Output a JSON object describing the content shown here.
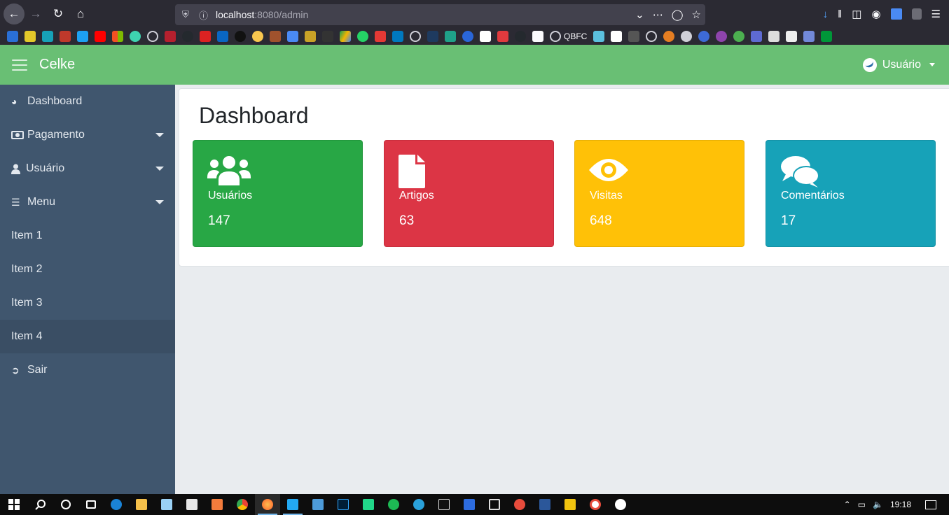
{
  "browser": {
    "url_host": "localhost",
    "url_path": ":8080/admin",
    "bookmark_qbfc": "QBFC"
  },
  "navbar": {
    "brand": "Celke",
    "user_label": "Usuário"
  },
  "sidebar": {
    "items": [
      {
        "label": "Dashboard",
        "icon": "tachometer-icon"
      },
      {
        "label": "Pagamento",
        "icon": "money-icon"
      },
      {
        "label": "Usuário",
        "icon": "user-icon"
      },
      {
        "label": "Menu",
        "icon": "list-icon"
      },
      {
        "label": "Item 1"
      },
      {
        "label": "Item 2"
      },
      {
        "label": "Item 3"
      },
      {
        "label": "Item 4"
      },
      {
        "label": "Sair",
        "icon": "sign-out-icon"
      }
    ]
  },
  "main": {
    "title": "Dashboard",
    "cards": [
      {
        "label": "Usuários",
        "value": "147",
        "color": "#28a745",
        "icon": "users-icon"
      },
      {
        "label": "Artigos",
        "value": "63",
        "color": "#dc3545",
        "icon": "file-icon"
      },
      {
        "label": "Visitas",
        "value": "648",
        "color": "#ffc107",
        "icon": "eye-icon"
      },
      {
        "label": "Comentários",
        "value": "17",
        "color": "#17a2b8",
        "icon": "comments-icon"
      }
    ]
  },
  "taskbar": {
    "clock": "19:18"
  }
}
